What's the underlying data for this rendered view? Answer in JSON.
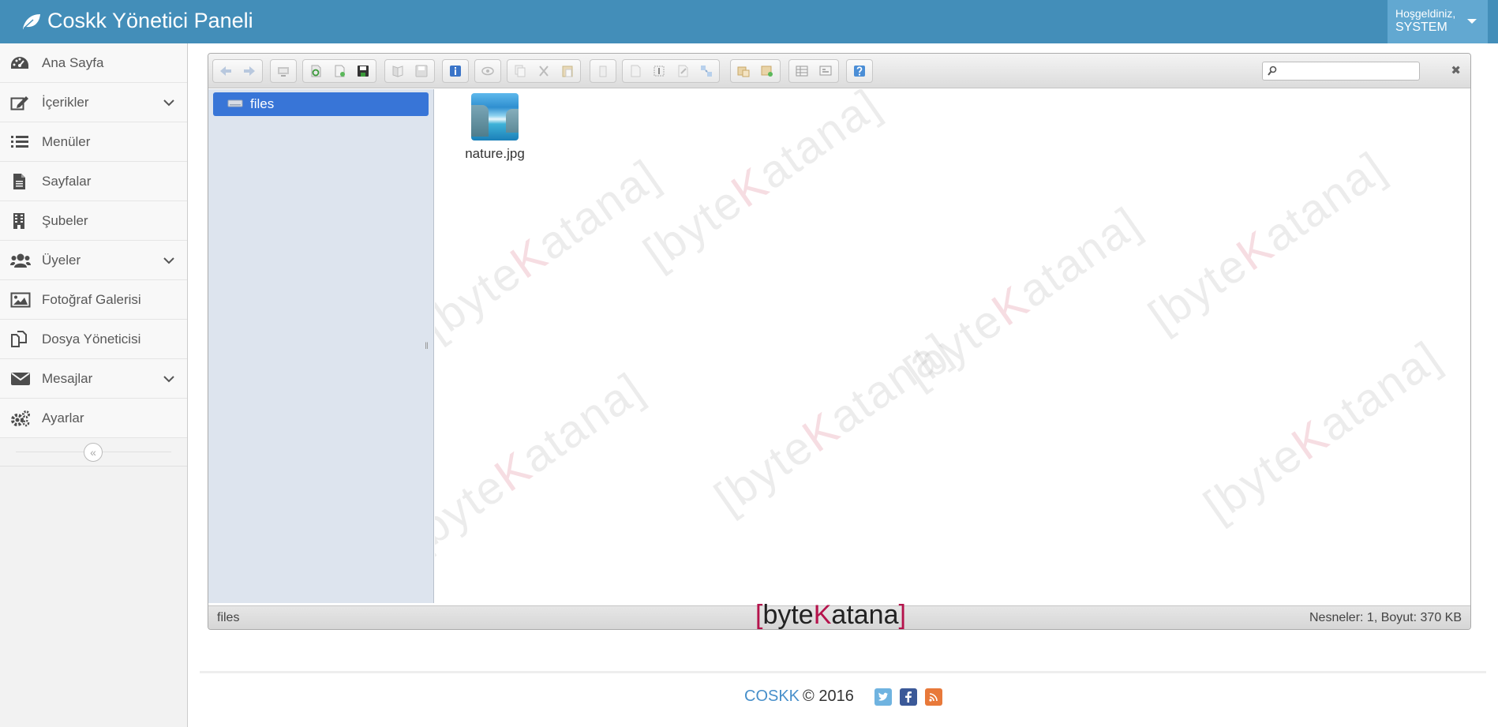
{
  "app": {
    "title": "Coskk Yönetici Paneli",
    "welcome": "Hoşgeldiniz,",
    "username": "SYSTEM"
  },
  "sidebar": {
    "items": [
      {
        "label": "Ana Sayfa",
        "icon": "dashboard-icon",
        "expandable": false
      },
      {
        "label": "İçerikler",
        "icon": "edit-icon",
        "expandable": true
      },
      {
        "label": "Menüler",
        "icon": "list-icon",
        "expandable": false
      },
      {
        "label": "Sayfalar",
        "icon": "file-icon",
        "expandable": false
      },
      {
        "label": "Şubeler",
        "icon": "building-icon",
        "expandable": false
      },
      {
        "label": "Üyeler",
        "icon": "users-icon",
        "expandable": true
      },
      {
        "label": "Fotoğraf Galerisi",
        "icon": "image-icon",
        "expandable": false
      },
      {
        "label": "Dosya Yöneticisi",
        "icon": "files-icon",
        "expandable": false
      },
      {
        "label": "Mesajlar",
        "icon": "envelope-icon",
        "expandable": true
      },
      {
        "label": "Ayarlar",
        "icon": "cogs-icon",
        "expandable": false
      }
    ],
    "collapse_glyph": "«"
  },
  "filemanager": {
    "tree_root": "files",
    "files": [
      {
        "name": "nature.jpg",
        "type": "image"
      }
    ],
    "statusbar": {
      "path": "files",
      "stats": "Nesneler: 1, Boyut: 370 KB"
    },
    "search": {
      "value": "",
      "placeholder": ""
    },
    "close_glyph": "✖",
    "watermark": [
      "[byte",
      "K",
      "atana]"
    ],
    "logo": {
      "bracket_open": "[",
      "part1": "byte",
      "k": "K",
      "part2": "atana",
      "bracket_close": "]"
    },
    "toolbar_icons": [
      "back-icon",
      "forward-icon",
      "home-icon",
      "reload-icon",
      "new-file-icon",
      "upload-icon",
      "open-icon",
      "save-icon",
      "info-icon",
      "preview-icon",
      "copy-icon",
      "cut-icon",
      "paste-icon",
      "delete-icon",
      "duplicate-icon",
      "rename-icon",
      "edit-icon",
      "resize-icon",
      "extract-icon",
      "archive-icon",
      "view-icon",
      "sort-icon",
      "help-icon"
    ]
  },
  "footer": {
    "brand": "COSKK",
    "copyright": "© 2016",
    "social": [
      "twitter-icon",
      "facebook-icon",
      "rss-icon"
    ]
  },
  "colors": {
    "navbar": "#438eb9",
    "user_menu": "#62a8d1",
    "tree_selected": "#3875d7",
    "brand_link": "#478fca",
    "logo_accent": "#b5134c"
  }
}
